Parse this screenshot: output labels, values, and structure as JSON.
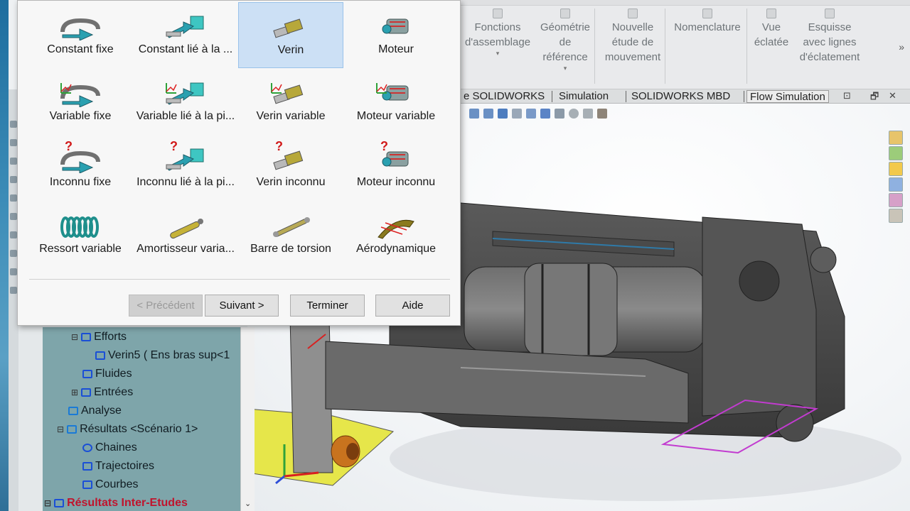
{
  "ribbon": {
    "groups": [
      {
        "label": "Fonctions d'assemblage",
        "lines": [
          "Fonctions",
          "d'assemblage"
        ],
        "has_caret": true
      },
      {
        "label": "Géométrie de référence",
        "lines": [
          "Géométrie",
          "de",
          "référence"
        ],
        "has_caret": true
      },
      {
        "label": "Nouvelle étude de mouvement",
        "lines": [
          "Nouvelle",
          "étude de",
          "mouvement"
        ]
      },
      {
        "label": "Nomenclature",
        "lines": [
          "Nomenclature"
        ]
      },
      {
        "label": "Vue éclatée",
        "lines": [
          "Vue",
          "éclatée"
        ]
      },
      {
        "label": "Esquisse avec lignes d'éclatement",
        "lines": [
          "Esquisse",
          "avec lignes",
          "d'éclatement"
        ]
      }
    ],
    "more": "»"
  },
  "tabs": [
    "e SOLIDWORKS",
    "Simulation",
    "SOLIDWORKS MBD",
    "Flow Simulation"
  ],
  "window_controls": [
    "⊡",
    "🗗",
    "✕"
  ],
  "dialog": {
    "items": [
      {
        "label": "Constant fixe",
        "icon": "constant-fixed-icon",
        "kind": "fixed",
        "unknown": false
      },
      {
        "label": "Constant lié à la ...",
        "icon": "constant-linked-icon",
        "kind": "linked",
        "unknown": false
      },
      {
        "label": "Verin",
        "icon": "actuator-icon",
        "kind": "actuator",
        "unknown": false,
        "selected": true
      },
      {
        "label": "Moteur",
        "icon": "motor-icon",
        "kind": "motor",
        "unknown": false
      },
      {
        "label": "Variable fixe",
        "icon": "variable-fixed-icon",
        "kind": "fixed",
        "unknown": false,
        "variable": true
      },
      {
        "label": "Variable lié à la pi...",
        "icon": "variable-linked-icon",
        "kind": "linked",
        "unknown": false,
        "variable": true
      },
      {
        "label": "Verin variable",
        "icon": "variable-actuator-icon",
        "kind": "actuator",
        "unknown": false,
        "variable": true
      },
      {
        "label": "Moteur variable",
        "icon": "variable-motor-icon",
        "kind": "motor",
        "unknown": false,
        "variable": true
      },
      {
        "label": "Inconnu fixe",
        "icon": "unknown-fixed-icon",
        "kind": "fixed",
        "unknown": true
      },
      {
        "label": "Inconnu lié à la pi...",
        "icon": "unknown-linked-icon",
        "kind": "linked",
        "unknown": true
      },
      {
        "label": "Verin inconnu",
        "icon": "unknown-actuator-icon",
        "kind": "actuator",
        "unknown": true
      },
      {
        "label": "Moteur inconnu",
        "icon": "unknown-motor-icon",
        "kind": "motor",
        "unknown": true
      },
      {
        "label": "Ressort variable",
        "icon": "spring-icon",
        "kind": "spring",
        "unknown": false
      },
      {
        "label": "Amortisseur varia...",
        "icon": "damper-icon",
        "kind": "damper",
        "unknown": false
      },
      {
        "label": "Barre de torsion",
        "icon": "torsion-bar-icon",
        "kind": "torsion",
        "unknown": false
      },
      {
        "label": "Aérodynamique",
        "icon": "aerodynamic-icon",
        "kind": "aero",
        "unknown": false
      }
    ],
    "buttons": {
      "prev": "< Précédent",
      "next": "Suivant >",
      "finish": "Terminer",
      "help": "Aide"
    }
  },
  "tree": {
    "items": [
      {
        "label": "Efforts",
        "icon": "forces-icon",
        "expander": "⊟"
      },
      {
        "label": "Verin5 ( Ens bras sup<1",
        "icon": "actuator-node-icon"
      },
      {
        "label": "Fluides",
        "icon": "fluids-icon"
      },
      {
        "label": "Entrées",
        "icon": "inputs-icon",
        "expander": "⊞"
      },
      {
        "label": "Analyse",
        "icon": "analysis-icon"
      },
      {
        "label": "Résultats <Scénario 1>",
        "icon": "results-icon",
        "expander": "⊟"
      },
      {
        "label": "Chaines",
        "icon": "chains-icon"
      },
      {
        "label": "Trajectoires",
        "icon": "trajectories-icon"
      },
      {
        "label": "Courbes",
        "icon": "curves-icon"
      },
      {
        "label": "Résultats Inter-Etudes",
        "icon": "inter-study-results-icon",
        "expander": "⊟"
      }
    ],
    "scroll_arrow": "⌄"
  },
  "colors": {
    "selection": "#cce0f5",
    "tree_panel": "#7ea5aa",
    "accent_red": "#c0142d",
    "yellow_part": "#e6e64a",
    "magenta_sketch": "#c23bd0"
  }
}
